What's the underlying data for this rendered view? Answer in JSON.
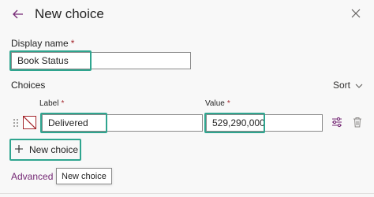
{
  "header": {
    "title": "New choice",
    "back_icon": "arrow-left-icon",
    "close_icon": "close-icon"
  },
  "display_name": {
    "label": "Display name",
    "required_marker": "*",
    "value": "Book Status"
  },
  "choices": {
    "label": "Choices",
    "sort_label": "Sort",
    "columns": {
      "label": "Label",
      "value": "Value",
      "required_marker": "*"
    },
    "items": [
      {
        "label": "Delivered",
        "value": "529,290,000",
        "color": "none"
      }
    ],
    "new_choice_label": "New choice"
  },
  "advanced_link_label": "Advanced o",
  "tooltip": "New choice",
  "colors": {
    "highlight": "#2fa58f",
    "accent": "#742774",
    "required": "#a4262c"
  }
}
